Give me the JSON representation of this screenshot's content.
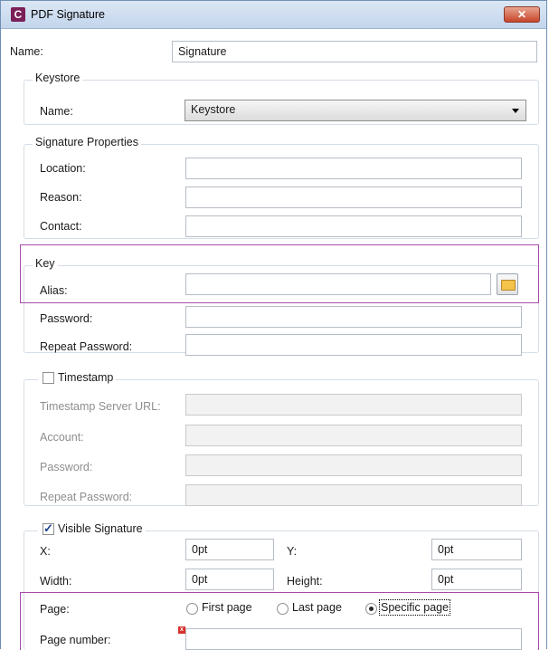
{
  "window": {
    "icon": "C",
    "title": "PDF Signature",
    "close": "✕"
  },
  "name": {
    "label": "Name:",
    "value": "Signature"
  },
  "keystore": {
    "group": "Keystore",
    "label": "Name:",
    "selected": "Keystore"
  },
  "properties": {
    "group": "Signature Properties",
    "location": {
      "label": "Location:",
      "value": ""
    },
    "reason": {
      "label": "Reason:",
      "value": ""
    },
    "contact": {
      "label": "Contact:",
      "value": ""
    }
  },
  "key": {
    "group": "Key",
    "alias": {
      "label": "Alias:",
      "value": ""
    },
    "password": {
      "label": "Password:",
      "value": ""
    },
    "repeat": {
      "label": "Repeat Password:",
      "value": ""
    }
  },
  "timestamp": {
    "group": "Timestamp",
    "checked": false,
    "server": {
      "label": "Timestamp Server URL:",
      "value": ""
    },
    "account": {
      "label": "Account:",
      "value": ""
    },
    "password": {
      "label": "Password:",
      "value": ""
    },
    "repeat": {
      "label": "Repeat Password:",
      "value": ""
    }
  },
  "visible": {
    "group": "Visible Signature",
    "checked": true,
    "x": {
      "label": "X:",
      "value": "0pt"
    },
    "y": {
      "label": "Y:",
      "value": "0pt"
    },
    "width": {
      "label": "Width:",
      "value": "0pt"
    },
    "height": {
      "label": "Height:",
      "value": "0pt"
    },
    "page": {
      "label": "Page:",
      "options": [
        "First page",
        "Last page",
        "Specific page"
      ],
      "selected": "Specific page"
    },
    "page_number": {
      "label": "Page number:",
      "value": ""
    }
  },
  "icons": {
    "browse": "folder-icon",
    "error": "error-marker-icon"
  }
}
